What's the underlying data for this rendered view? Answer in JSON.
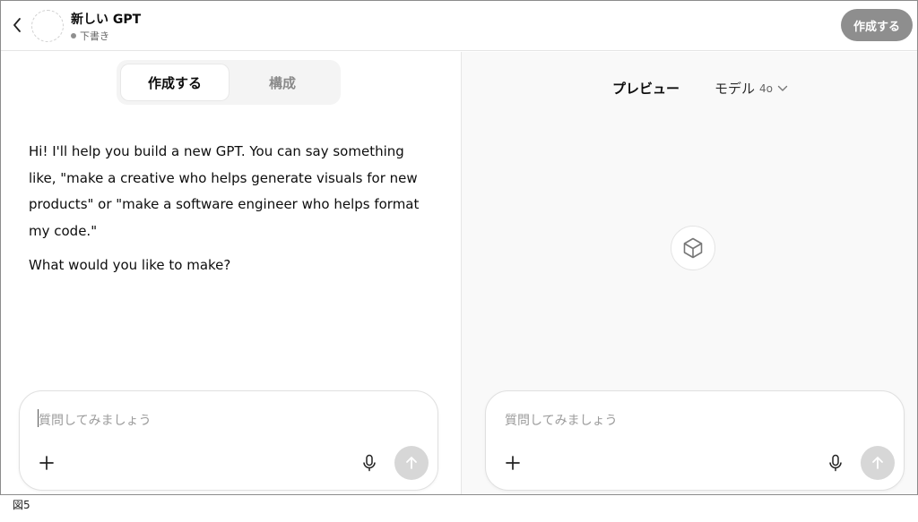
{
  "header": {
    "title": "新しい GPT",
    "status": "下書き",
    "create_button": "作成する"
  },
  "left_panel": {
    "tabs": [
      {
        "label": "作成する",
        "active": true
      },
      {
        "label": "構成",
        "active": false
      }
    ],
    "messages": [
      "Hi! I'll help you build a new GPT. You can say something like, \"make a creative who helps generate visuals for new products\" or \"make a software engineer who helps format my code.\"",
      "What would you like to make?"
    ],
    "composer": {
      "placeholder": "質問してみましょう"
    }
  },
  "right_panel": {
    "title": "プレビュー",
    "model_label": "モデル",
    "model_version": "4o",
    "composer": {
      "placeholder": "質問してみましょう"
    }
  },
  "caption": "図5",
  "colors": {
    "create_button_bg": "#8e8e8e",
    "send_button_bg": "#d7d7d7",
    "preview_bg": "#f9f9f9"
  }
}
